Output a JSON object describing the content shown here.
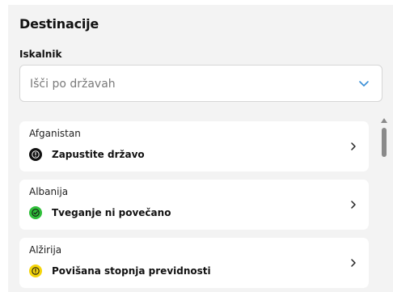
{
  "section": {
    "title": "Destinacije"
  },
  "search": {
    "label": "Iskalnik",
    "placeholder": "Išči po državah",
    "value": ""
  },
  "countries": [
    {
      "name": "Afganistan",
      "status": "Zapustite državo",
      "status_color": "#111111",
      "icon": "exclamation-icon"
    },
    {
      "name": "Albanija",
      "status": "Tveganje ni povečano",
      "status_color": "#2fbf3a",
      "icon": "check-icon"
    },
    {
      "name": "Alžirija",
      "status": "Povišana stopnja previdnosti",
      "status_color": "#f5d50b",
      "icon": "exclamation-icon"
    }
  ]
}
